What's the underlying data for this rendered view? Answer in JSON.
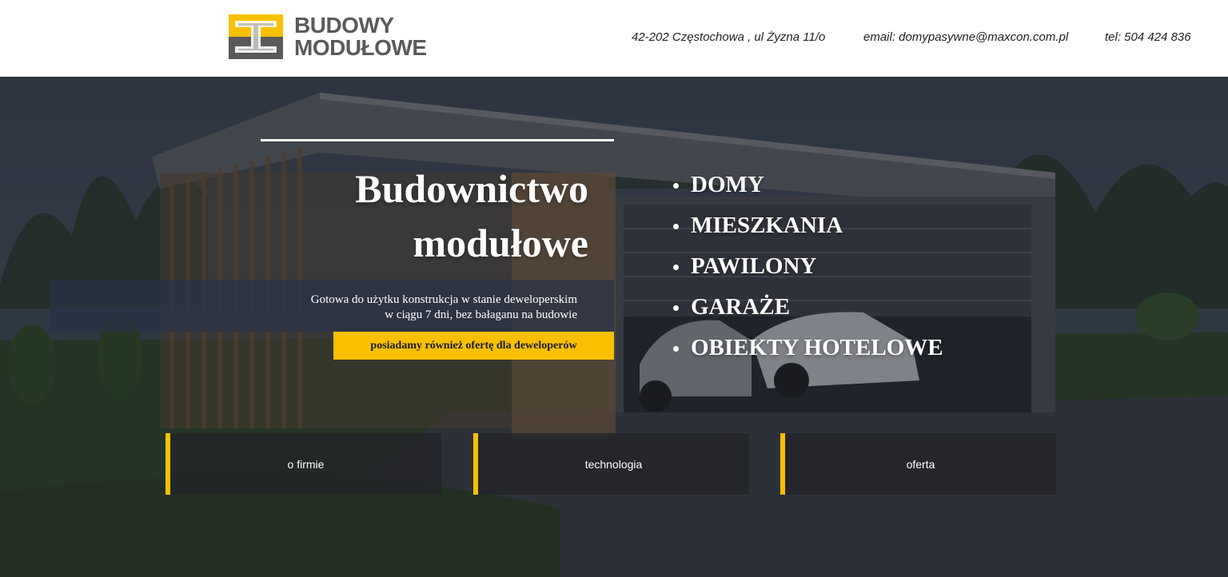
{
  "header": {
    "logo": {
      "line1": "BUDOWY",
      "line2": "MODUŁOWE",
      "icon": "i-beam-logo-icon"
    },
    "address": "42-202 Częstochowa , ul Żyzna 11/o",
    "email": "email: domypasywne@maxcon.com.pl",
    "phone": "tel: 504 424 836"
  },
  "hero": {
    "title_line1": "Budownictwo",
    "title_line2": "modułowe",
    "tagline_line1": "Gotowa do użytku konstrukcja w stanie deweloperskim",
    "tagline_line2": "w ciągu 7 dni, bez bałaganu na budowie",
    "developer_button": "posiadamy również ofertę dla deweloperów",
    "categories": [
      "DOMY",
      "MIESZKANIA",
      "PAWILONY",
      "GARAŻE",
      "OBIEKTY HOTELOWE"
    ]
  },
  "nav": {
    "tiles": [
      "o firmie",
      "technologia",
      "oferta"
    ]
  },
  "colors": {
    "accent": "#f8c000",
    "logo_gray": "#5a5a5a",
    "tile_bg": "#232428",
    "tagline_bg": "#283248"
  }
}
